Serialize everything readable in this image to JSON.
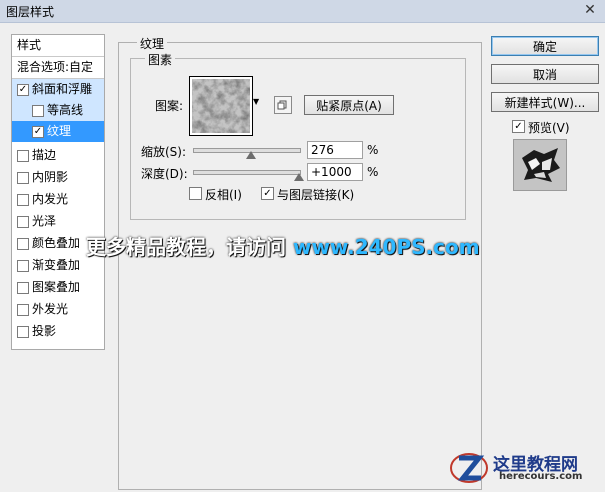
{
  "window": {
    "title": "图层样式",
    "close": "✕"
  },
  "left_panel": {
    "header": "样式",
    "blend": "混合选项:自定",
    "items": [
      {
        "label": "斜面和浮雕",
        "checked": true
      },
      {
        "label": "等高线",
        "checked": false
      },
      {
        "label": "纹理",
        "checked": true
      },
      {
        "label": "描边",
        "checked": false
      },
      {
        "label": "内阴影",
        "checked": false
      },
      {
        "label": "内发光",
        "checked": false
      },
      {
        "label": "光泽",
        "checked": false
      },
      {
        "label": "颜色叠加",
        "checked": false
      },
      {
        "label": "渐变叠加",
        "checked": false
      },
      {
        "label": "图案叠加",
        "checked": false
      },
      {
        "label": "外发光",
        "checked": false
      },
      {
        "label": "投影",
        "checked": false
      }
    ]
  },
  "texture": {
    "group_title": "纹理",
    "subgroup_title": "图素",
    "pattern_label": "图案:",
    "snap_button": "贴紧原点(A)",
    "scale_label": "缩放(S):",
    "scale_value": "276",
    "depth_label": "深度(D):",
    "depth_value": "+1000",
    "percent": "%",
    "invert_label": "反相(I)",
    "invert_checked": false,
    "link_label": "与图层链接(K)",
    "link_checked": true,
    "scale_slider_fraction": 0.55,
    "depth_slider_fraction": 1.0
  },
  "buttons": {
    "ok": "确定",
    "cancel": "取消",
    "new_style": "新建样式(W)...",
    "preview_label": "预览(V)",
    "preview_checked": true
  },
  "watermark": {
    "text": "更多精品教程，请访问",
    "url": "www.240PS.com"
  },
  "corner_logo": {
    "title": "这里教程网",
    "url": "herecours.com"
  },
  "glyphs": {
    "check": "✓",
    "dropdown": "▸"
  }
}
